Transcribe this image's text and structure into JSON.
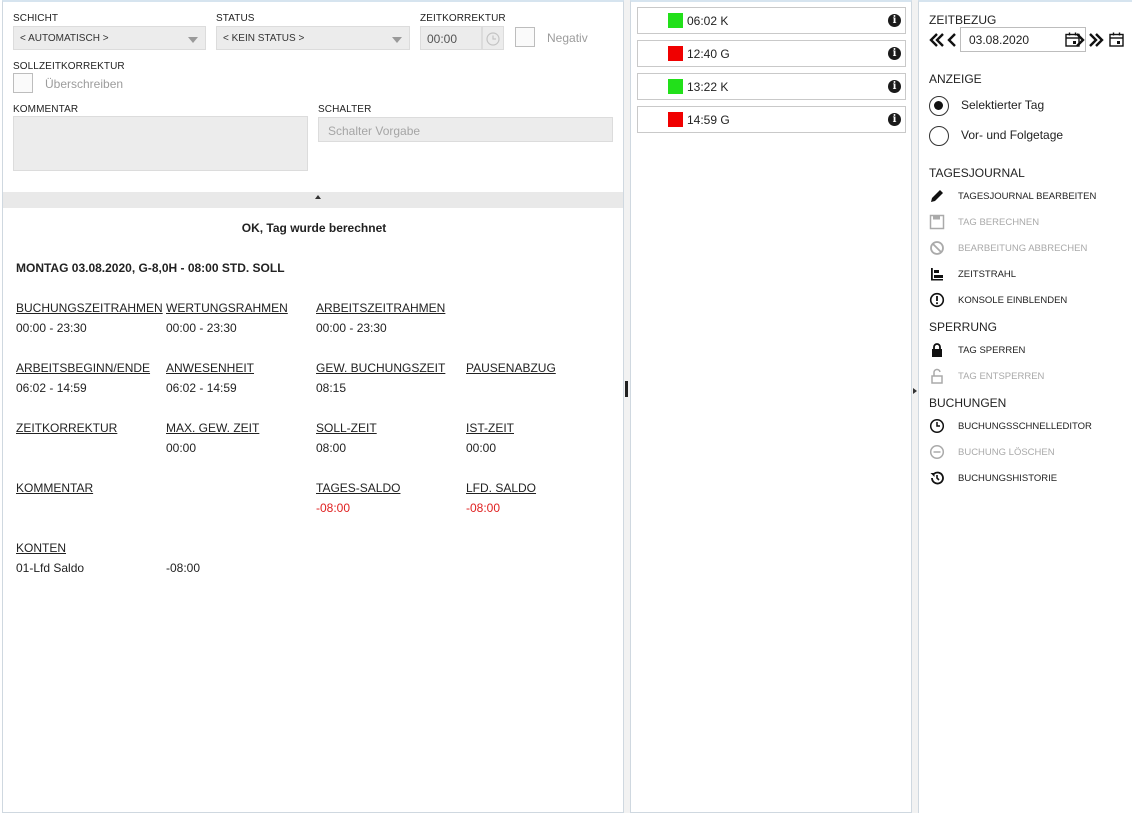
{
  "form": {
    "schicht_label": "SCHICHT",
    "schicht_value": "< AUTOMATISCH >",
    "status_label": "STATUS",
    "status_value": "< KEIN STATUS >",
    "zeitkorrektur_label": "ZEITKORREKTUR",
    "zeitkorrektur_value": "00:00",
    "negativ_label": "Negativ",
    "sollzeit_label": "SOLLZEITKORREKTUR",
    "ueberschreiben_label": "Überschreiben",
    "kommentar_label": "KOMMENTAR",
    "kommentar_value": "",
    "schalter_label": "SCHALTER",
    "schalter_placeholder": "Schalter Vorgabe"
  },
  "journal": {
    "status_message": "OK, Tag wurde berechnet",
    "day_header": "MONTAG 03.08.2020, G-8,0H - 08:00 STD. SOLL",
    "rows": [
      [
        {
          "label": "BUCHUNGSZEITRAHMEN",
          "value": "00:00 - 23:30"
        },
        {
          "label": "WERTUNGSRAHMEN",
          "value": "00:00 - 23:30"
        },
        {
          "label": "ARBEITSZEITRAHMEN",
          "value": "00:00 - 23:30"
        }
      ],
      [
        {
          "label": "ARBEITSBEGINN/ENDE",
          "value": "06:02 - 14:59"
        },
        {
          "label": "ANWESENHEIT",
          "value": "06:02 - 14:59"
        },
        {
          "label": "GEW. BUCHUNGSZEIT",
          "value": "08:15"
        },
        {
          "label": "PAUSENABZUG",
          "value": ""
        }
      ],
      [
        {
          "label": "ZEITKORREKTUR",
          "value": ""
        },
        {
          "label": "MAX. GEW. ZEIT",
          "value": "00:00"
        },
        {
          "label": "SOLL-ZEIT",
          "value": "08:00"
        },
        {
          "label": "IST-ZEIT",
          "value": "00:00"
        }
      ],
      [
        {
          "label": "KOMMENTAR",
          "value": ""
        },
        {
          "label": "",
          "value": ""
        },
        {
          "label": "TAGES-SALDO",
          "value": "-08:00"
        },
        {
          "label": "LFD. SALDO",
          "value": "-08:00"
        }
      ]
    ],
    "konten_label": "KONTEN",
    "konten_name": "01-Lfd Saldo",
    "konten_value": "-08:00",
    "negative_color": "#e02020"
  },
  "bookings": [
    {
      "time": "06:02 K",
      "color": "#22e01a"
    },
    {
      "time": "12:40 G",
      "color": "#f00000"
    },
    {
      "time": "13:22 K",
      "color": "#22e01a"
    },
    {
      "time": "14:59 G",
      "color": "#f00000"
    }
  ],
  "sidebar": {
    "zeitbezug_label": "ZEITBEZUG",
    "date_value": "03.08.2020",
    "anzeige_label": "ANZEIGE",
    "radio_selected_label": "Selektierter Tag",
    "radio_other_label": "Vor- und Folgetage",
    "tagesjournal_label": "TAGESJOURNAL",
    "tagesjournal_actions": [
      {
        "label": "TAGESJOURNAL BEARBEITEN",
        "icon": "pencil-icon",
        "enabled": true
      },
      {
        "label": "TAG BERECHNEN",
        "icon": "save-icon",
        "enabled": false
      },
      {
        "label": "BEARBEITUNG ABBRECHEN",
        "icon": "cancel-icon",
        "enabled": false
      },
      {
        "label": "ZEITSTRAHL",
        "icon": "timeline-icon",
        "enabled": true
      },
      {
        "label": "KONSOLE EINBLENDEN",
        "icon": "alert-icon",
        "enabled": true
      }
    ],
    "sperrung_label": "SPERRUNG",
    "sperrung_actions": [
      {
        "label": "TAG SPERREN",
        "icon": "lock-icon",
        "enabled": true
      },
      {
        "label": "TAG ENTSPERREN",
        "icon": "unlock-icon",
        "enabled": false
      }
    ],
    "buchungen_label": "BUCHUNGEN",
    "buchungen_actions": [
      {
        "label": "BUCHUNGSSCHNELLEDITOR",
        "icon": "clock-icon",
        "enabled": true
      },
      {
        "label": "BUCHUNG LÖSCHEN",
        "icon": "minus-circle-icon",
        "enabled": false
      },
      {
        "label": "BUCHUNGSHISTORIE",
        "icon": "history-icon",
        "enabled": true
      }
    ]
  }
}
